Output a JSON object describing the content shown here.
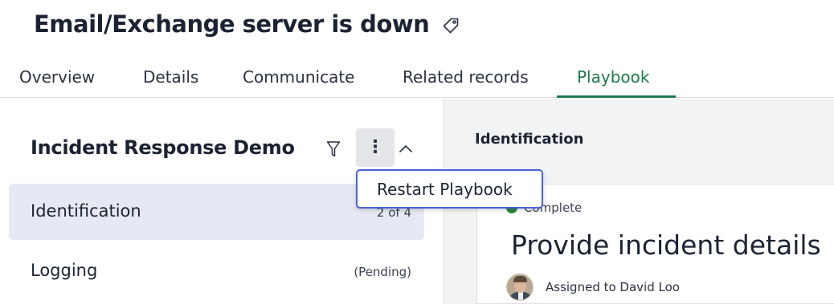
{
  "page": {
    "title": "Email/Exchange server is down",
    "tag_icon": "tag-icon"
  },
  "tabs": [
    {
      "label": "Overview",
      "active": false
    },
    {
      "label": "Details",
      "active": false
    },
    {
      "label": "Communicate",
      "active": false
    },
    {
      "label": "Related records",
      "active": false
    },
    {
      "label": "Playbook",
      "active": true
    }
  ],
  "playbook": {
    "title": "Incident Response Demo",
    "filter_icon": "filter-icon",
    "more_icon": "more-vertical-icon",
    "collapse_icon": "chevron-up-icon",
    "stages": [
      {
        "name": "Identification",
        "count": "2 of 4",
        "active": true
      },
      {
        "name": "Logging",
        "count": "(Pending)",
        "active": false
      }
    ]
  },
  "menu": {
    "items": [
      {
        "label": "Restart Playbook"
      }
    ]
  },
  "detail": {
    "header": "Identification",
    "task": {
      "status": "Complete",
      "title": "Provide incident details",
      "assigned": "Assigned to David Loo"
    }
  },
  "colors": {
    "accent": "#1f7a4d",
    "active_stage_bg": "#e6e8f3",
    "menu_border": "#4a62d8",
    "status_complete": "#2d8a3e"
  }
}
